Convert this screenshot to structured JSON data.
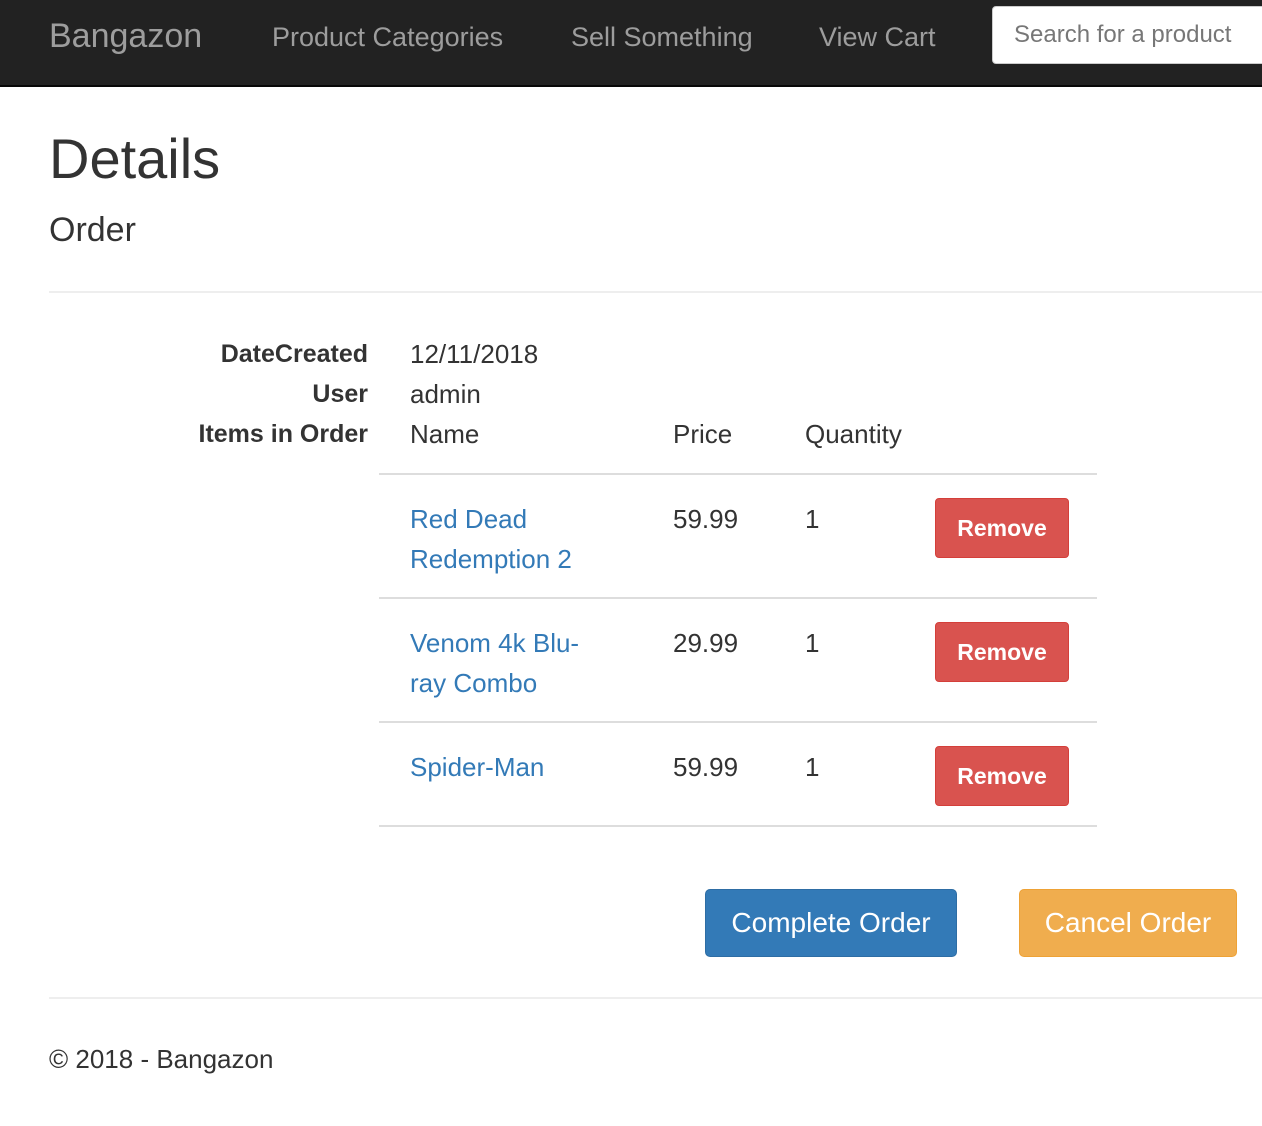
{
  "navbar": {
    "brand": "Bangazon",
    "links": [
      "Product Categories",
      "Sell Something",
      "View Cart"
    ],
    "search_placeholder": "Search for a product"
  },
  "page": {
    "title": "Details",
    "subtitle": "Order"
  },
  "order": {
    "date_created_label": "DateCreated",
    "date_created": "12/11/2018",
    "user_label": "User",
    "user": "admin",
    "items_label": "Items in Order",
    "columns": [
      "Name",
      "Price",
      "Quantity"
    ],
    "items": [
      {
        "name": "Red Dead Redemption 2",
        "price": "59.99",
        "quantity": "1",
        "action": "Remove"
      },
      {
        "name": "Venom 4k Blu-ray Combo",
        "price": "29.99",
        "quantity": "1",
        "action": "Remove"
      },
      {
        "name": "Spider-Man",
        "price": "59.99",
        "quantity": "1",
        "action": "Remove"
      }
    ]
  },
  "actions": {
    "complete": "Complete Order",
    "cancel": "Cancel Order"
  },
  "footer": {
    "text": "© 2018 - Bangazon"
  },
  "colors": {
    "navbar_bg": "#222222",
    "link": "#337ab7",
    "danger": "#d9534f",
    "primary": "#337ab7",
    "warning": "#f0ad4e"
  }
}
